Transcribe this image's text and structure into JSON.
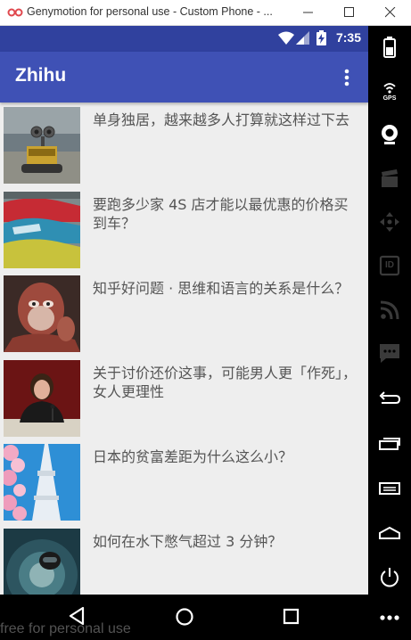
{
  "window": {
    "title": "Genymotion for personal use - Custom Phone - ..."
  },
  "statusbar": {
    "time": "7:35"
  },
  "app": {
    "title": "Zhihu"
  },
  "stories": [
    {
      "title": "单身独居，越来越多人打算就这样过下去",
      "thumb": "robot-toy"
    },
    {
      "title": "要跑多少家 4S 店才能以最优惠的价格买到车？",
      "thumb": "car-lot"
    },
    {
      "title": "知乎好问题 · 思维和语言的关系是什么？",
      "thumb": "monkey-statue"
    },
    {
      "title": "关于讨价还价这事，可能男人更「作死」，女人更理性",
      "thumb": "speaker-woman"
    },
    {
      "title": "日本的贫富差距为什么这么小？",
      "thumb": "tokyo-tower-blossom"
    },
    {
      "title": "如何在水下憋气超过 3 分钟？",
      "thumb": "underwater-diver"
    }
  ],
  "toolbar": {
    "gps_label": "GPS",
    "id_label": "ID"
  },
  "watermark": "free for personal use",
  "colors": {
    "appbar": "#3f51b5",
    "statusbar": "#30419e",
    "background": "#eeeeee"
  }
}
